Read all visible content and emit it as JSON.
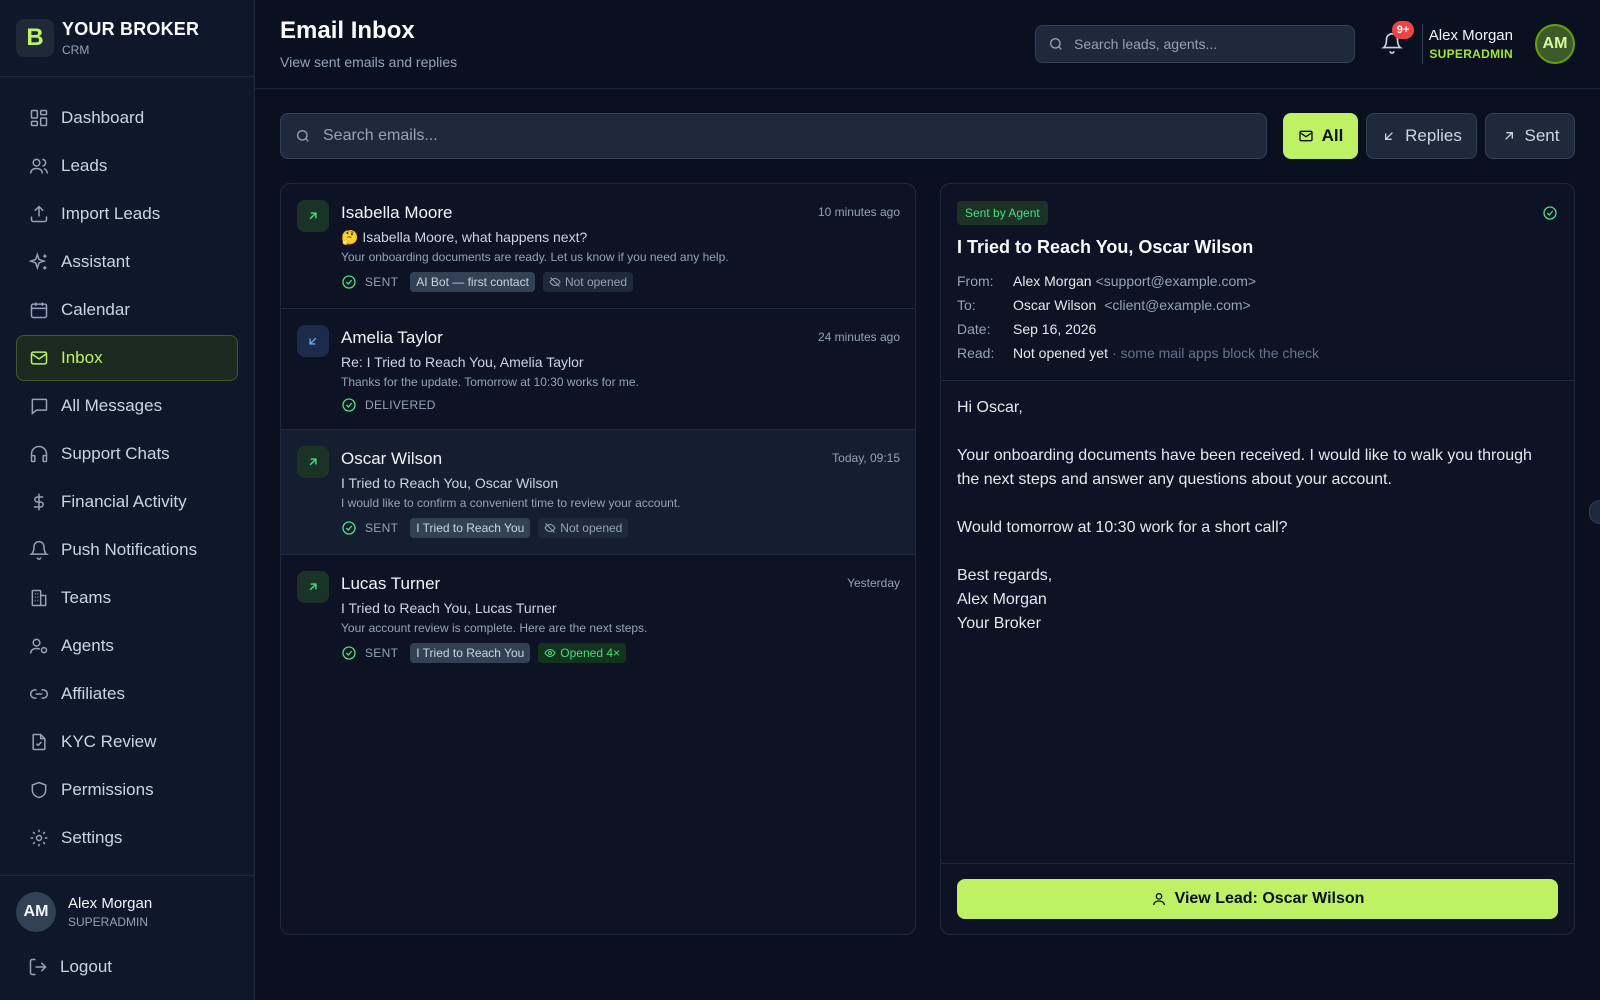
{
  "brand": {
    "logo_letter": "B",
    "name": "YOUR BROKER",
    "sub": "CRM"
  },
  "sidebar": {
    "items": [
      {
        "label": "Dashboard",
        "icon": "dashboard-icon"
      },
      {
        "label": "Leads",
        "icon": "users-icon"
      },
      {
        "label": "Import Leads",
        "icon": "upload-icon"
      },
      {
        "label": "Assistant",
        "icon": "sparkles-icon"
      },
      {
        "label": "Calendar",
        "icon": "calendar-icon"
      },
      {
        "label": "Inbox",
        "icon": "mail-icon",
        "active": true
      },
      {
        "label": "All Messages",
        "icon": "message-icon"
      },
      {
        "label": "Support Chats",
        "icon": "headphones-icon"
      },
      {
        "label": "Financial Activity",
        "icon": "dollar-icon"
      },
      {
        "label": "Push Notifications",
        "icon": "bell-icon"
      },
      {
        "label": "Teams",
        "icon": "building-icon"
      },
      {
        "label": "Agents",
        "icon": "user-cog-icon"
      },
      {
        "label": "Affiliates",
        "icon": "link-icon"
      },
      {
        "label": "KYC Review",
        "icon": "file-check-icon"
      },
      {
        "label": "Permissions",
        "icon": "shield-icon"
      },
      {
        "label": "Settings",
        "icon": "gear-icon"
      }
    ],
    "user": {
      "initials": "AM",
      "name": "Alex Morgan",
      "role": "SUPERADMIN"
    },
    "logout_label": "Logout"
  },
  "header": {
    "title": "Email Inbox",
    "subtitle": "View sent emails and replies",
    "search_placeholder": "Search leads, agents...",
    "notif_badge": "9+",
    "user_name": "Alex Morgan",
    "user_role": "SUPERADMIN",
    "user_initials": "AM"
  },
  "toolbar": {
    "search_placeholder": "Search emails...",
    "filters": {
      "all": "All",
      "replies": "Replies",
      "sent": "Sent"
    }
  },
  "emails": [
    {
      "name": "Isabella Moore",
      "time": "10 minutes ago",
      "direction": "out",
      "subject": "🤔 Isabella Moore, what happens next?",
      "preview": "Your onboarding documents are ready. Let us know if you need any help.",
      "status": "SENT",
      "campaign": "AI Bot — first contact",
      "opened": "Not opened"
    },
    {
      "name": "Amelia Taylor",
      "time": "24 minutes ago",
      "direction": "in",
      "subject": "Re: I Tried to Reach You, Amelia Taylor",
      "preview": "Thanks for the update. Tomorrow at 10:30 works for me.",
      "status": "DELIVERED"
    },
    {
      "name": "Oscar Wilson",
      "time": "Today, 09:15",
      "direction": "out",
      "subject": "I Tried to Reach You, Oscar Wilson",
      "preview": "I would like to confirm a convenient time to review your account.",
      "status": "SENT",
      "campaign": "I Tried to Reach You",
      "opened": "Not opened"
    },
    {
      "name": "Lucas Turner",
      "time": "Yesterday",
      "direction": "out",
      "subject": "I Tried to Reach You, Lucas Turner",
      "preview": "Your account review is complete. Here are the next steps.",
      "status": "SENT",
      "campaign": "I Tried to Reach You",
      "opened": "Opened 4×"
    }
  ],
  "detail": {
    "badge": "Sent by Agent",
    "subject": "I Tried to Reach You, Oscar Wilson",
    "labels": {
      "from": "From:",
      "to": "To:",
      "date": "Date:",
      "read": "Read:"
    },
    "from_name": "Alex Morgan",
    "from_email": "<support@example.com>",
    "to_name": "Oscar Wilson",
    "to_email": "<client@example.com>",
    "date": "Sep 16, 2026",
    "read_status": "Not opened yet",
    "read_note": "· some mail apps block the check",
    "body": {
      "greeting": "Hi Oscar,",
      "p1": "Your onboarding documents have been received. I would like to walk you through the next steps and answer any questions about your account.",
      "p2": "Would tomorrow at 10:30 work for a short call?",
      "closing": "Best regards,",
      "sig_name": "Alex Morgan",
      "sig_company": "Your Broker"
    },
    "view_lead": "View Lead: Oscar Wilson"
  }
}
